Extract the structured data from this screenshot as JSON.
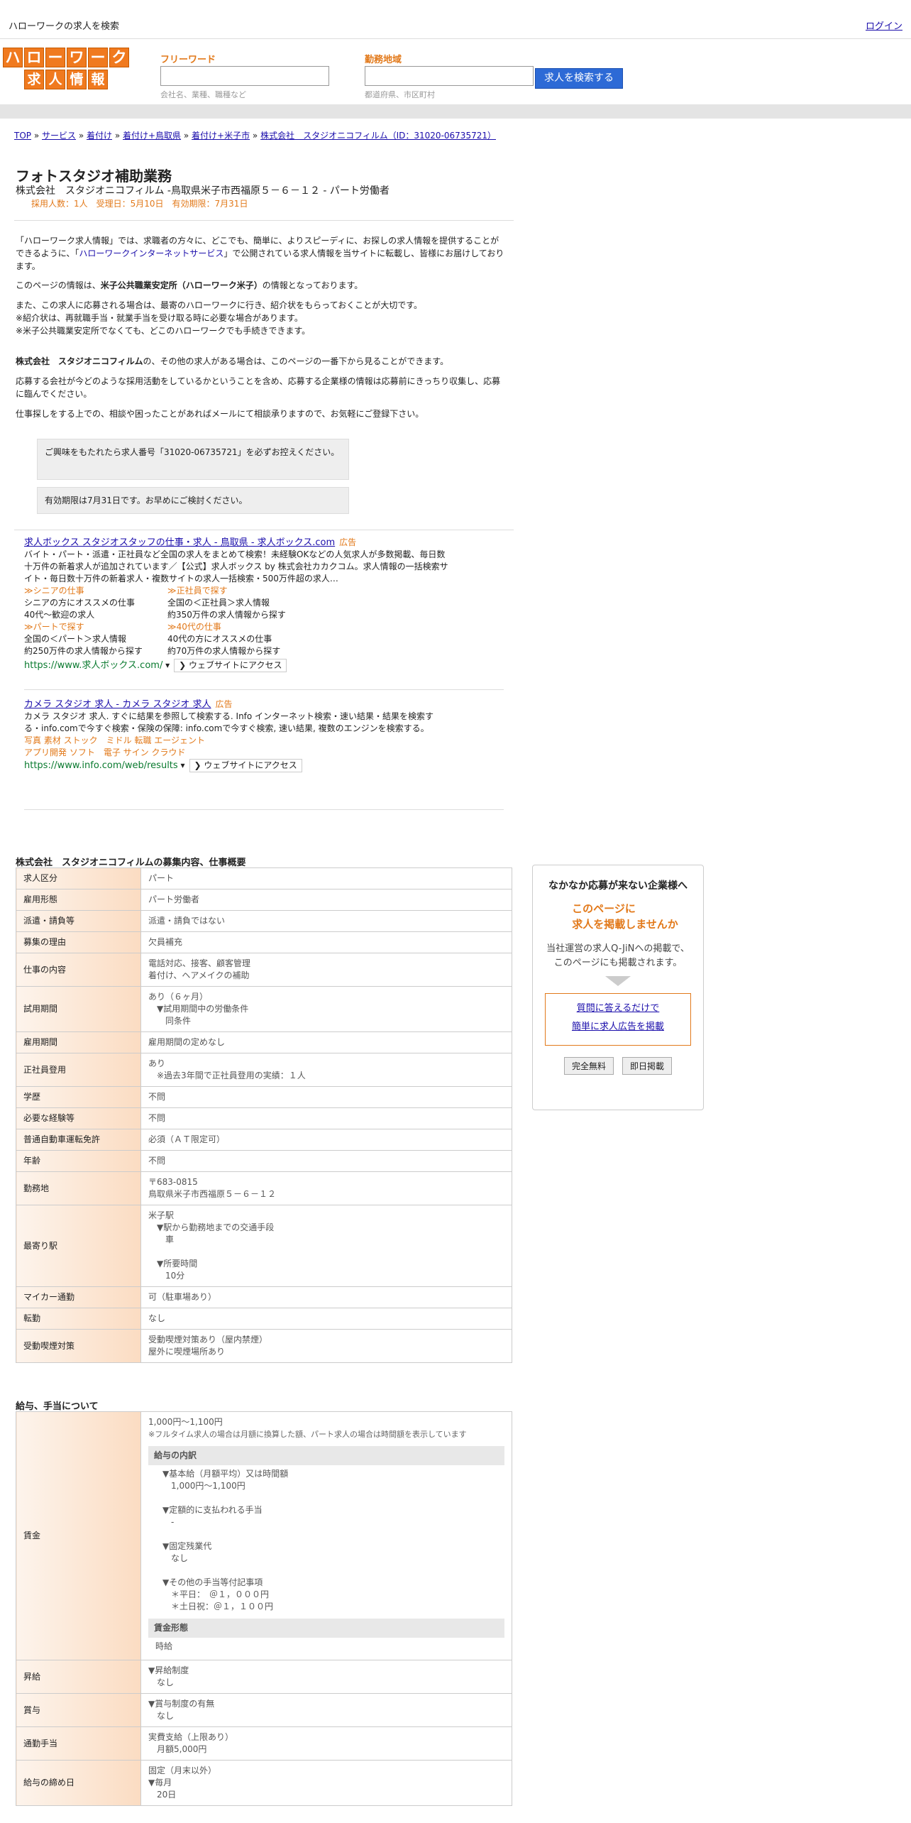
{
  "topbar": {
    "title": "ハローワークの求人を検索",
    "login": "ログイン"
  },
  "logo": {
    "row1": [
      "ハ",
      "ロ",
      "ー",
      "ワ",
      "ー",
      "ク"
    ],
    "row2": [
      "求",
      "人",
      "情",
      "報"
    ]
  },
  "search": {
    "keyword_label": "フリーワード",
    "keyword_hint": "会社名、業種、職種など",
    "area_label": "勤務地域",
    "area_hint": "都道府県、市区町村",
    "button": "求人を検索する"
  },
  "breadcrumb": {
    "items": [
      "TOP",
      "サービス",
      "着付け",
      "着付け+鳥取県",
      "着付け+米子市",
      "株式会社　スタジオニコフィルム（ID：31020-06735721）"
    ]
  },
  "job": {
    "title": "フォトスタジオ補助業務",
    "subtitle": "株式会社　スタジオニコフィルム -鳥取県米子市西福原５－６－１２ - パート労働者",
    "meta": "採用人数：1人　受理日：5月10日　有効期限：7月31日"
  },
  "intro": {
    "p1a": "「ハローワーク求人情報」では、求職者の方々に、どこでも、簡単に、よりスピーディに、お探しの求人情報を提供することができるように、「",
    "p1link": "ハローワークインターネットサービス",
    "p1b": "」で公開されている求人情報を当サイトに転載し、皆様にお届けしております。",
    "p2a": "このページの情報は、",
    "p2b": "米子公共職業安定所（ハローワーク米子）",
    "p2c": "の情報となっております。",
    "p3": "また、この求人に応募される場合は、最寄のハローワークに行き、紹介状をもらっておくことが大切です。",
    "p4": "※紹介状は、再就職手当・就業手当を受け取る時に必要な場合があります。",
    "p5": "※米子公共職業安定所でなくても、どこのハローワークでも手続きできます。",
    "p6a": "株式会社　スタジオニコフィルム",
    "p6b": "の、その他の求人がある場合は、このページの一番下から見ることができます。",
    "p7": "応募する会社が今どのような採用活動をしているかということを含め、応募する企業様の情報は応募前にきっちり収集し、応募に臨んでください。",
    "p8": "仕事探しをする上での、相談や困ったことがあればメールにて相談承りますので、お気軽にご登録下さい。"
  },
  "notices": [
    "ご興味をもたれたら求人番号「31020-06735721」を必ずお控えください。",
    "有効期限は7月31日です。お早めにご検討ください。"
  ],
  "ad1": {
    "title": "求人ボックス スタジオスタッフの仕事・求人 - 鳥取県 - 求人ボックス.com",
    "label": "広告",
    "desc": "バイト・パート・派遣・正社員など全国の求人をまとめて検索！未経験OKなどの人気求人が多数掲載、毎日数十万件の新着求人が追加されています／【公式】求人ボックス by 株式会社カカクコム。求人情報の一括検索サイト・毎日数十万件の新着求人・複数サイトの求人一括検索・500万件超の求人…",
    "links": [
      {
        "t": "≫シニアの仕事",
        "d1": "シニアの方にオススメの仕事",
        "d2": "40代～歓迎の求人"
      },
      {
        "t": "≫正社員で探す",
        "d1": "全国の＜正社員＞求人情報",
        "d2": "約350万件の求人情報から探す"
      },
      {
        "t": "≫パートで探す",
        "d1": "全国の＜パート＞求人情報",
        "d2": "約250万件の求人情報から探す"
      },
      {
        "t": "≫40代の仕事",
        "d1": "40代の方にオススメの仕事",
        "d2": "約70万件の求人情報から探す"
      }
    ],
    "url": "https://www.求人ボックス.com/",
    "visit": "❯ ウェブサイトにアクセス"
  },
  "ad2": {
    "title": "カメラ スタジオ 求人 - カメラ スタジオ 求人",
    "label": "広告",
    "desc": "カメラ スタジオ 求人. すぐに結果を参照して検索する. Info インターネット検索・速い結果・結果を検索する・info.comで今すぐ検索・保険の保障: info.comで今すぐ検索, 速い結果, 複数のエンジンを検索する。",
    "sl1": "写真 素材 ストック　ミドル 転職 エージェント",
    "sl2": "アプリ開発 ソフト　電子 サイン クラウド",
    "url": "https://www.info.com/web/results",
    "visit": "❯ ウェブサイトにアクセス"
  },
  "summary": {
    "heading": "株式会社　スタジオニコフィルムの募集内容、仕事概要",
    "rows": [
      {
        "k": "求人区分",
        "v": [
          "パート"
        ]
      },
      {
        "k": "雇用形態",
        "v": [
          "パート労働者"
        ]
      },
      {
        "k": "派遣・請負等",
        "v": [
          "派遣・請負ではない"
        ]
      },
      {
        "k": "募集の理由",
        "v": [
          "欠員補充"
        ]
      },
      {
        "k": "仕事の内容",
        "v": [
          "電話対応、接客、顧客管理",
          "着付け、ヘアメイクの補助"
        ]
      },
      {
        "k": "試用期間",
        "v": [
          "あり（６ヶ月）",
          "　▼試用期間中の労働条件",
          "　　同条件"
        ]
      },
      {
        "k": "雇用期間",
        "v": [
          "雇用期間の定めなし"
        ]
      },
      {
        "k": "正社員登用",
        "v": [
          "あり",
          "　※過去3年間で正社員登用の実績：１人"
        ]
      },
      {
        "k": "学歴",
        "v": [
          "不問"
        ]
      },
      {
        "k": "必要な経験等",
        "v": [
          "不問"
        ]
      },
      {
        "k": "普通自動車運転免許",
        "v": [
          "必須（ＡＴ限定可）"
        ]
      },
      {
        "k": "年齢",
        "v": [
          "不問"
        ]
      },
      {
        "k": "勤務地",
        "v": [
          "〒683-0815",
          "鳥取県米子市西福原５－６－１２"
        ]
      },
      {
        "k": "最寄り駅",
        "v": [
          "米子駅",
          "　▼駅から勤務地までの交通手段",
          "　　車",
          "",
          "　▼所要時間",
          "　　10分"
        ]
      },
      {
        "k": "マイカー通勤",
        "v": [
          "可（駐車場あり）"
        ]
      },
      {
        "k": "転勤",
        "v": [
          "なし"
        ]
      },
      {
        "k": "受動喫煙対策",
        "v": [
          "受動喫煙対策あり（屋内禁煙）",
          "屋外に喫煙場所あり"
        ]
      }
    ]
  },
  "side": {
    "heading": "なかなか応募が来ない企業様へ",
    "orange1": "このページに",
    "orange2": "求人を掲載しませんか",
    "text1": "当社運営の求人Q-JiNへの掲載で、",
    "text2": "このページにも掲載されます。",
    "link1": "質問に答えるだけで",
    "link2": "簡単に求人広告を掲載",
    "btn1": "完全無料",
    "btn2": "即日掲載"
  },
  "pay": {
    "heading": "給与、手当について",
    "wage_key": "賃金",
    "wage_main": "1,000円〜1,100円",
    "wage_note": "※フルタイム求人の場合は月額に換算した額、パート求人の場合は時間額を表示しています",
    "breakdown_title": "給与の内訳",
    "breakdown": [
      "▼基本給（月額平均）又は時間額",
      "　1,000円〜1,100円",
      "",
      "▼定額的に支払われる手当",
      "　-",
      "",
      "▼固定残業代",
      "　なし",
      "",
      "▼その他の手当等付記事項",
      "　＊平日：　＠１，０００円",
      "　＊土日祝：＠１，１００円"
    ],
    "form_title": "賃金形態",
    "form_value": "時給",
    "rows": [
      {
        "k": "昇給",
        "v": [
          "▼昇給制度",
          "　なし"
        ]
      },
      {
        "k": "賞与",
        "v": [
          "▼賞与制度の有無",
          "　なし"
        ]
      },
      {
        "k": "通勤手当",
        "v": [
          "実費支給（上限あり）",
          "　月額5,000円"
        ]
      },
      {
        "k": "給与の締め日",
        "v": [
          "固定（月末以外）",
          "▼毎月",
          "　20日"
        ]
      }
    ]
  }
}
